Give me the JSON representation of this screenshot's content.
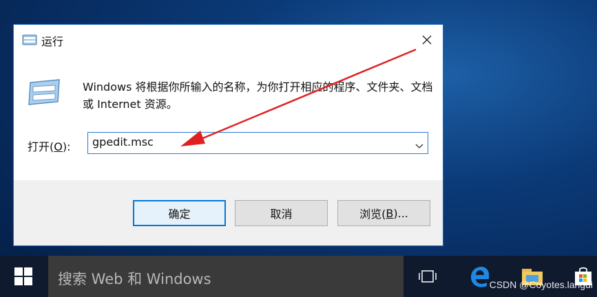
{
  "dialog": {
    "title": "运行",
    "description": "Windows 将根据你所输入的名称，为你打开相应的程序、文件夹、文档或 Internet 资源。",
    "open_label_prefix": "打开(",
    "open_label_key": "O",
    "open_label_suffix": "):",
    "open_value": "gpedit.msc",
    "ok_label": "确定",
    "cancel_label": "取消",
    "browse_prefix": "浏览(",
    "browse_key": "B",
    "browse_suffix": ")..."
  },
  "taskbar": {
    "search_placeholder": "搜索 Web 和 Windows",
    "icons": [
      "windows-logo-icon",
      "task-view-icon",
      "edge-icon",
      "file-explorer-icon",
      "store-icon"
    ]
  },
  "watermark": "CSDN @Coyotes.langdi",
  "colors": {
    "accent": "#0078d7",
    "arrow": "#e02020",
    "taskbar": "#0f1a2e"
  }
}
